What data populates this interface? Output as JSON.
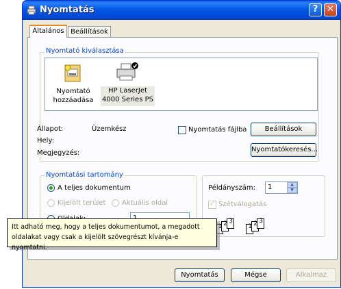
{
  "window": {
    "title": "Nyomtatás",
    "help_label": "?",
    "close_label": "✕"
  },
  "tabs": [
    {
      "label": "Általános"
    },
    {
      "label": "Beállítások"
    }
  ],
  "printer_group": {
    "title": "Nyomtató kiválasztása",
    "printers": [
      {
        "line1": "Nyomtató",
        "line2": "hozzáadása",
        "icon": "add-printer-icon"
      },
      {
        "line1": "HP LaserJet",
        "line2": "4000 Series PS",
        "icon": "printer-icon",
        "selected": true
      }
    ],
    "status_label": "Állapot:",
    "status_value": "Üzemkész",
    "location_label": "Hely:",
    "comment_label": "Megjegyzés:",
    "print_to_file_label": "Nyomtatás fájlba",
    "print_to_file_checked": false,
    "preferences_button": "Beállítások",
    "find_printer_button": "Nyomtatókeresés..."
  },
  "range_group": {
    "title": "Nyomtatási tartomány",
    "all_label": "A teljes dokumentum",
    "selection_label": "Kijelölt terület",
    "current_label": "Aktuális oldal",
    "pages_label": "Oldalak:",
    "pages_value": "1"
  },
  "copies": {
    "label": "Példányszám:",
    "value": "1",
    "collate_label": "Szétválogatás",
    "collate_checked": true,
    "collate_pages": [
      "1",
      "2",
      "3",
      "1",
      "2",
      "3"
    ]
  },
  "tooltip": {
    "line1": "Itt adható meg, hogy a teljes dokumentumot, a megadott",
    "line2": "oldalakat vagy csak a kijelölt szövegrészt kívánja-e nyomtatni."
  },
  "buttons": {
    "print": "Nyomtatás",
    "cancel": "Mégse",
    "apply": "Alkalmaz"
  },
  "colors": {
    "title_bar": "#0058e6",
    "group_title": "#0046d5",
    "dialog_bg": "#ece9d8",
    "tooltip_bg": "#ffffe1"
  }
}
